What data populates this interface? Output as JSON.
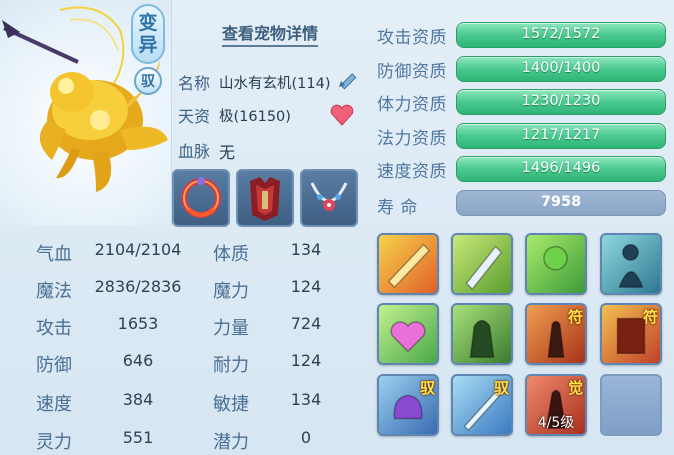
{
  "pet": {
    "transform_badge": [
      "变",
      "异"
    ],
    "tame_badge": "驭",
    "detail_link": "查看宠物详情",
    "name_label": "名称",
    "name_value": "山水有玄机(114)",
    "aptitude_label": "天资",
    "aptitude_value": "极(16150)",
    "bloodline_label": "血脉",
    "bloodline_value": "无"
  },
  "equipment": [
    {
      "name": "collar-ring-icon"
    },
    {
      "name": "armor-icon"
    },
    {
      "name": "necklace-icon"
    }
  ],
  "attributes": [
    {
      "label": "气血",
      "value": "2104/2104",
      "label2": "体质",
      "value2": "134"
    },
    {
      "label": "魔法",
      "value": "2836/2836",
      "label2": "魔力",
      "value2": "124"
    },
    {
      "label": "攻击",
      "value": "1653",
      "label2": "力量",
      "value2": "724"
    },
    {
      "label": "防御",
      "value": "646",
      "label2": "耐力",
      "value2": "124"
    },
    {
      "label": "速度",
      "value": "384",
      "label2": "敏捷",
      "value2": "134"
    },
    {
      "label": "灵力",
      "value": "551",
      "label2": "潜力",
      "value2": "0"
    }
  ],
  "aptitudes": [
    {
      "label": "攻击资质",
      "value": "1572/1572",
      "fill": 1.0
    },
    {
      "label": "防御资质",
      "value": "1400/1400",
      "fill": 1.0
    },
    {
      "label": "体力资质",
      "value": "1230/1230",
      "fill": 1.0
    },
    {
      "label": "法力资质",
      "value": "1217/1217",
      "fill": 1.0
    },
    {
      "label": "速度资质",
      "value": "1496/1496",
      "fill": 1.0
    }
  ],
  "lifespan": {
    "label": "寿    命",
    "value": "7958"
  },
  "skills": [
    {
      "name": "flame-sword-skill-icon",
      "tag": ""
    },
    {
      "name": "sword-strike-skill-icon",
      "tag": ""
    },
    {
      "name": "ghost-wind-skill-icon",
      "tag": ""
    },
    {
      "name": "shadow-figure-skill-icon",
      "tag": ""
    },
    {
      "name": "heart-shield-skill-icon",
      "tag": ""
    },
    {
      "name": "giant-warrior-skill-icon",
      "tag": ""
    },
    {
      "name": "rune-warrior-skill-icon",
      "tag": "符"
    },
    {
      "name": "rune-scroll-skill-icon",
      "tag": "符"
    },
    {
      "name": "purple-fist-skill-icon",
      "tag": "驭"
    },
    {
      "name": "ice-blade-skill-icon",
      "tag": "驭"
    },
    {
      "name": "awaken-skill-icon",
      "tag": "觉",
      "level": "4/5级"
    },
    {
      "name": "empty-skill-slot",
      "tag": ""
    }
  ],
  "colors": {
    "bar_green": "#49c98f",
    "life_bar": "#8aa6c7",
    "label_blue": "#4f77a2",
    "skill_border": "#5f86b2"
  }
}
